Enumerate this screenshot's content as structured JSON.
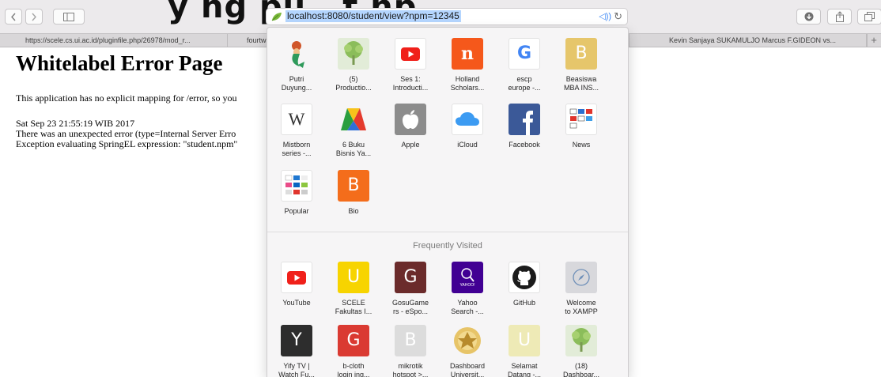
{
  "overlay_text": "y  ng pu       , t    np",
  "url": "localhost:8080/student/view?npm=12345",
  "tabs": [
    "https://scele.cs.ui.ac.id/pluginfile.php/26978/mod_r...",
    "fourtw",
    "Kevin Sanjaya SUKAMULJO Marcus F.GIDEON vs..."
  ],
  "tab_plus": "+",
  "page": {
    "title": "Whitelabel Error Page",
    "message": "This application has no explicit mapping for /error, so you",
    "timestamp": "Sat Sep 23 21:55:19 WIB 2017",
    "error_line": "There was an unexpected error (type=Internal Server Erro",
    "exception_line": "Exception evaluating SpringEL expression: \"student.npm\""
  },
  "favorites": {
    "row1": [
      {
        "l1": "Putri",
        "l2": "Duyung..."
      },
      {
        "l1": "(5)",
        "l2": "Productio..."
      },
      {
        "l1": "Ses 1:",
        "l2": "Introducti..."
      },
      {
        "l1": "Holland",
        "l2": "Scholars..."
      },
      {
        "l1": "escp",
        "l2": "europe -..."
      },
      {
        "l1": "Beasiswa",
        "l2": "MBA INS..."
      }
    ],
    "row2": [
      {
        "l1": "Mistborn",
        "l2": "series -..."
      },
      {
        "l1": "6 Buku",
        "l2": "Bisnis Ya..."
      },
      {
        "l1": "Apple",
        "l2": ""
      },
      {
        "l1": "iCloud",
        "l2": ""
      },
      {
        "l1": "Facebook",
        "l2": ""
      },
      {
        "l1": "News",
        "l2": ""
      }
    ],
    "row3": [
      {
        "l1": "Popular",
        "l2": ""
      },
      {
        "l1": "Bio",
        "l2": ""
      }
    ],
    "letters": {
      "holland": "n",
      "google": "G",
      "beasiswa": "B",
      "wiki": "W",
      "bio": "B"
    }
  },
  "frequently_visited": {
    "title": "Frequently Visited",
    "row1": [
      {
        "l1": "YouTube",
        "l2": ""
      },
      {
        "l1": "SCELE",
        "l2": "Fakultas I..."
      },
      {
        "l1": "GosuGame",
        "l2": "rs - eSpo..."
      },
      {
        "l1": "Yahoo",
        "l2": "Search -..."
      },
      {
        "l1": "GitHub",
        "l2": ""
      },
      {
        "l1": "Welcome",
        "l2": "to XAMPP"
      }
    ],
    "row2": [
      {
        "l1": "Yify TV |",
        "l2": "Watch Fu..."
      },
      {
        "l1": "b-cloth",
        "l2": "login ing..."
      },
      {
        "l1": "mikrotik",
        "l2": "hotspot >..."
      },
      {
        "l1": "Dashboard",
        "l2": "Universit..."
      },
      {
        "l1": "Selamat",
        "l2": "Datang -..."
      },
      {
        "l1": "(18)",
        "l2": "Dashboar..."
      }
    ],
    "letters": {
      "scele": "U",
      "gosu": "G",
      "yahoo_sub": "YAHOO!",
      "yify": "Y",
      "bcloth": "G",
      "mikrotik": "B",
      "selamat": "U"
    }
  },
  "colors": {
    "youtube": "#f0201a",
    "holland": "#f5581b",
    "beasiswa": "#e6c66b",
    "facebook": "#3b5998",
    "bio": "#f46d1b",
    "scele": "#f7d400",
    "gosu": "#6b2b2b",
    "yahoo": "#410093",
    "yify": "#2d2d2d",
    "bcloth": "#da3a32",
    "selamat": "#eeeab6",
    "url_highlight": "#b4d5fe"
  }
}
